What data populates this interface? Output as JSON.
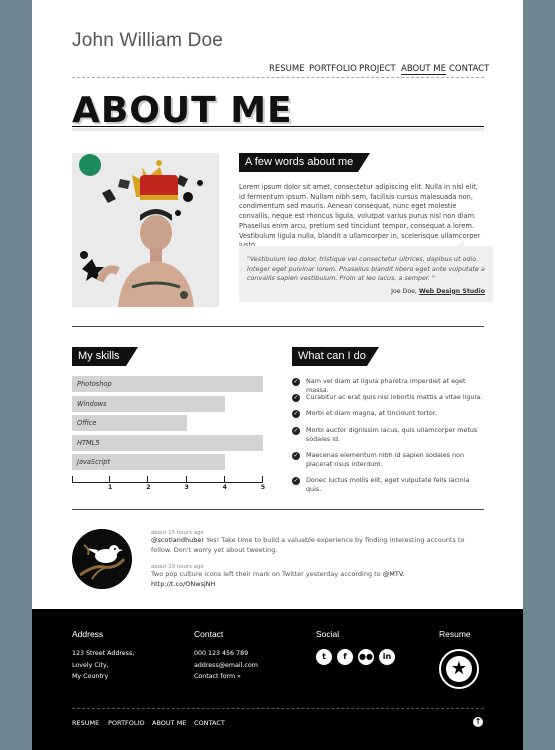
{
  "header": {
    "name": "John William Doe",
    "nav": [
      "RESUME",
      "PORTFOLIO",
      "PROJECT",
      "ABOUT ME",
      "CONTACT"
    ],
    "active_nav": "ABOUT ME"
  },
  "hero": {
    "title": "ABOUT ME"
  },
  "about": {
    "title": "A few words about me",
    "paragraph": "Lorem ipsum dolor sit amet, consectetur adipiscing elit. Nulla in nisl elit, id fermentum ipsum. Nullam nibh sem, facilisis cursus malesuada non, condimentum sed mauris. Aenean consequat, nunc eget molestie convallis, neque est rhoncus ligula, volutpat varius purus nisl non diam. Phasellus enim arcu, pretium sed tincidunt tempor, consequat a lorem. Vestibulum ligula nulla, blandit a ullamcorper in, scelerisque ullamcorper justo.",
    "quote": "\"Vestibulum leo dolor, tristique vel consectetur ultrices, dapibus ut odio. Integer eget pulvinar lorem. Phasellus blandit libero eget ante vulputate a convallis sapien vestibulum. Proin at leo lacus, a semper. \"",
    "quote_author": "Joe Doe,",
    "quote_link": "Web Design Studio"
  },
  "skills": {
    "title": "My skills",
    "items": [
      {
        "label": "Photoshop",
        "level": 5
      },
      {
        "label": "Windows",
        "level": 4
      },
      {
        "label": "Office",
        "level": 3
      },
      {
        "label": "HTML5",
        "level": 5
      },
      {
        "label": "JavaScript",
        "level": 4
      }
    ],
    "scale": [
      "1",
      "2",
      "3",
      "4",
      "5"
    ]
  },
  "can_do": {
    "title": "What can I do",
    "items": [
      "Nam vel diam at ligula pharetra imperdiet at eget massa.",
      "Curabitur ac erat quis nisl lobortis mattis a vitae ligula.",
      "Morbi et diam magna, at tincidunt tortor.",
      "Morbi auctor dignissim lacus, quis ullamcorper metus sodales id.",
      "Maecenas elementum nibh id sapien sodales non placerat risus interdum.",
      "Donec luctus mollis elit, eget vulputate felis lacinia quis."
    ]
  },
  "tweets": [
    {
      "time": "about 15 hours ago",
      "user": "@scotlandhuber",
      "text": " Yes! Take time to build a valuable experience by finding interesting accounts to follow. Don't worry yet about tweeting."
    },
    {
      "time": "about 19 hours ago",
      "text": "Two pop culture icons left their mark on Twitter yesterday according to ",
      "mention": "@MTV",
      "link": ". http://t.co/ONwsjNH"
    }
  ],
  "footer": {
    "address_title": "Address",
    "address_lines": [
      "123 Street Address,",
      "Lovely City,",
      "My Country"
    ],
    "contact_title": "Contact",
    "contact_lines": [
      "000 123 456 789",
      "address@email.com",
      "Contact form »"
    ],
    "social_title": "Social",
    "social_icons": [
      "twitter-icon",
      "facebook-icon",
      "flickr-icon",
      "linkedin-icon"
    ],
    "resume_title": "Resume",
    "nav": [
      "RESUME",
      "PORTFOLIO",
      "ABOUT ME",
      "CONTACT"
    ]
  },
  "colors": {
    "background": "#6f8591",
    "accent": "#111111",
    "skill_bar": "#d3d3d3"
  }
}
